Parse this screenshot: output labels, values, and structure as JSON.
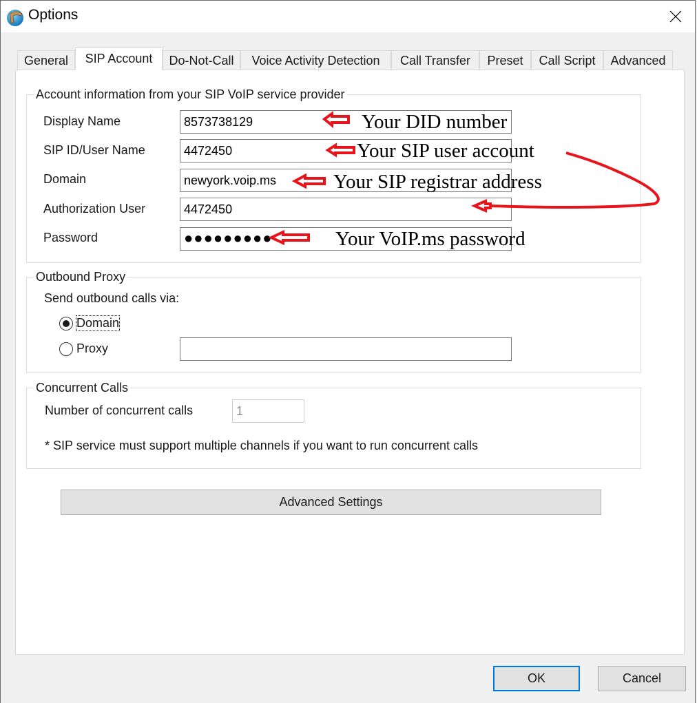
{
  "window": {
    "title": "Options",
    "icon": "phone-globe-icon",
    "close_icon": "close-icon"
  },
  "tabs": [
    {
      "label": "General",
      "active": false
    },
    {
      "label": "SIP Account",
      "active": true
    },
    {
      "label": "Do-Not-Call",
      "active": false
    },
    {
      "label": "Voice Activity Detection",
      "active": false
    },
    {
      "label": "Call Transfer",
      "active": false
    },
    {
      "label": "Preset",
      "active": false
    },
    {
      "label": "Call Script",
      "active": false
    },
    {
      "label": "Advanced",
      "active": false
    }
  ],
  "account": {
    "legend": "Account information from your SIP VoIP service provider",
    "fields": [
      {
        "label": "Display Name",
        "value": "8573738129"
      },
      {
        "label": "SIP ID/User Name",
        "value": "4472450"
      },
      {
        "label": "Domain",
        "value": "newyork.voip.ms"
      },
      {
        "label": "Authorization User",
        "value": "4472450"
      },
      {
        "label": "Password",
        "value": "●●●●●●●●●"
      }
    ]
  },
  "annotations": {
    "did": "Your DID number",
    "sip_user": "Your SIP user account",
    "registrar": "Your SIP registrar address",
    "password": "Your VoIP.ms password",
    "color": "#e8141c"
  },
  "outbound": {
    "legend": "Outbound Proxy",
    "prompt": "Send outbound calls via:",
    "options": [
      {
        "label": "Domain",
        "checked": true
      },
      {
        "label": "Proxy",
        "checked": false
      }
    ],
    "proxy_value": ""
  },
  "concurrent": {
    "legend": "Concurrent Calls",
    "label": "Number of concurrent calls",
    "value": "1",
    "note": "* SIP service must support multiple channels if you want to run concurrent calls"
  },
  "buttons": {
    "advanced": "Advanced Settings",
    "ok": "OK",
    "cancel": "Cancel"
  }
}
